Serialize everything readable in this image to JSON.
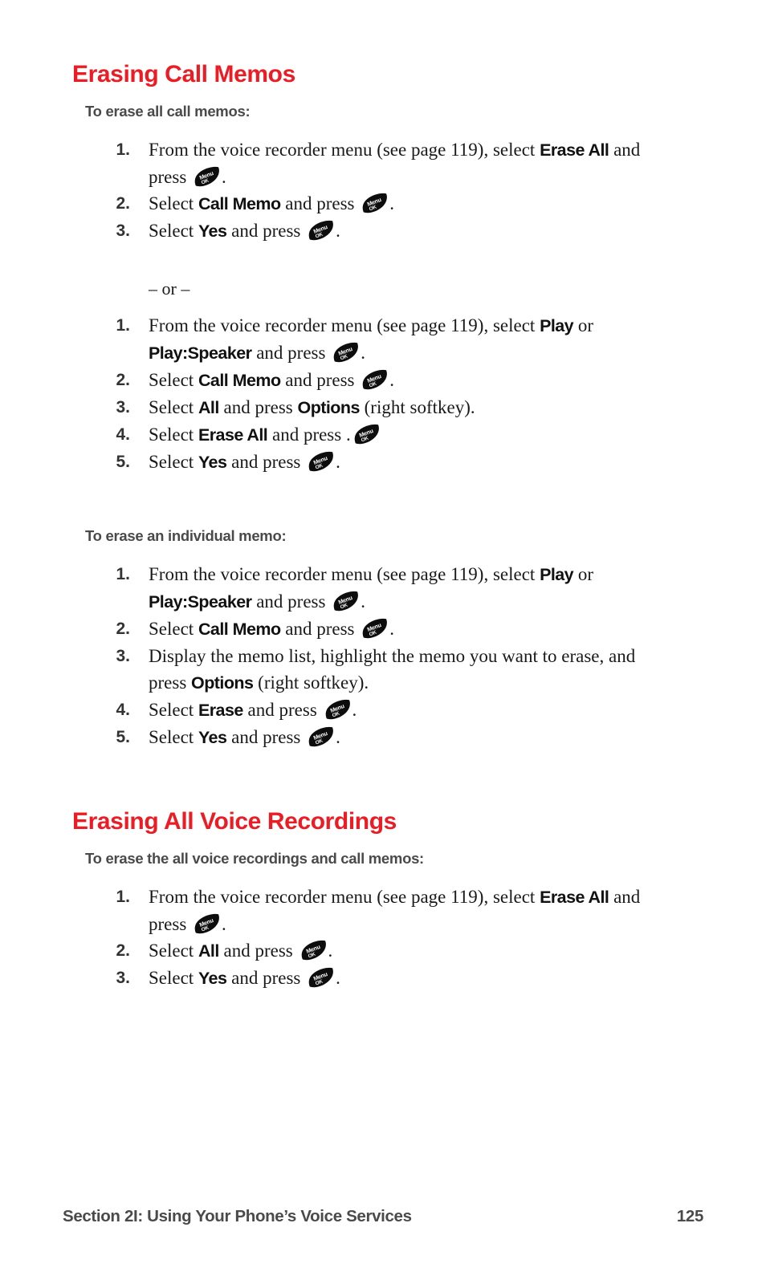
{
  "page": {
    "number": "125",
    "footer_section": "Section 2I: Using Your Phone’s Voice Services",
    "accent_color": "#ec1c24",
    "body_color": "#1a1a1a",
    "subheading_color": "#4a4a4a"
  },
  "icons": {
    "menu_ok": {
      "line1": "Menu",
      "line2": "OK",
      "name": "menu-ok-key-icon"
    }
  },
  "sections": [
    {
      "heading": "Erasing Call Memos",
      "groups": [
        {
          "subheading": "To erase all call memos:",
          "steps": [
            {
              "num": "1.",
              "parts": [
                {
                  "t": "text",
                  "v": "From the voice recorder menu (see page 119), select "
                },
                {
                  "t": "ui",
                  "v": "Erase All"
                },
                {
                  "t": "text",
                  "v": " and press "
                },
                {
                  "t": "icon",
                  "v": "menu_ok"
                },
                {
                  "t": "text",
                  "v": "."
                }
              ]
            },
            {
              "num": "2.",
              "parts": [
                {
                  "t": "text",
                  "v": "Select "
                },
                {
                  "t": "ui",
                  "v": "Call Memo"
                },
                {
                  "t": "text",
                  "v": " and press "
                },
                {
                  "t": "icon",
                  "v": "menu_ok"
                },
                {
                  "t": "text",
                  "v": "."
                }
              ]
            },
            {
              "num": "3.",
              "parts": [
                {
                  "t": "text",
                  "v": "Select "
                },
                {
                  "t": "ui",
                  "v": "Yes"
                },
                {
                  "t": "text",
                  "v": " and press "
                },
                {
                  "t": "icon",
                  "v": "menu_ok"
                },
                {
                  "t": "text",
                  "v": "."
                }
              ]
            }
          ],
          "separator": "– or –",
          "steps_alt": [
            {
              "num": "1.",
              "parts": [
                {
                  "t": "text",
                  "v": "From the voice recorder menu (see page 119), select "
                },
                {
                  "t": "ui",
                  "v": "Play"
                },
                {
                  "t": "text",
                  "v": " or "
                },
                {
                  "t": "ui",
                  "v": "Play:Speaker"
                },
                {
                  "t": "text",
                  "v": " and press "
                },
                {
                  "t": "icon",
                  "v": "menu_ok"
                },
                {
                  "t": "text",
                  "v": "."
                }
              ]
            },
            {
              "num": "2.",
              "parts": [
                {
                  "t": "text",
                  "v": "Select "
                },
                {
                  "t": "ui",
                  "v": "Call Memo"
                },
                {
                  "t": "text",
                  "v": " and press "
                },
                {
                  "t": "icon",
                  "v": "menu_ok"
                },
                {
                  "t": "text",
                  "v": "."
                }
              ]
            },
            {
              "num": "3.",
              "parts": [
                {
                  "t": "text",
                  "v": "Select "
                },
                {
                  "t": "ui",
                  "v": "All"
                },
                {
                  "t": "text",
                  "v": " and press "
                },
                {
                  "t": "ui",
                  "v": "Options"
                },
                {
                  "t": "text",
                  "v": " (right softkey)."
                }
              ]
            },
            {
              "num": "4.",
              "parts": [
                {
                  "t": "text",
                  "v": "Select "
                },
                {
                  "t": "ui",
                  "v": "Erase All"
                },
                {
                  "t": "text",
                  "v": " and press ."
                },
                {
                  "t": "icon",
                  "v": "menu_ok"
                }
              ]
            },
            {
              "num": "5.",
              "parts": [
                {
                  "t": "text",
                  "v": "Select "
                },
                {
                  "t": "ui",
                  "v": "Yes"
                },
                {
                  "t": "text",
                  "v": " and press "
                },
                {
                  "t": "icon",
                  "v": "menu_ok"
                },
                {
                  "t": "text",
                  "v": "."
                }
              ]
            }
          ]
        },
        {
          "subheading": "To erase an individual memo:",
          "steps": [
            {
              "num": "1.",
              "parts": [
                {
                  "t": "text",
                  "v": "From the voice recorder menu (see page 119), select "
                },
                {
                  "t": "ui",
                  "v": "Play"
                },
                {
                  "t": "text",
                  "v": " or "
                },
                {
                  "t": "ui",
                  "v": "Play:Speaker"
                },
                {
                  "t": "text",
                  "v": " and press "
                },
                {
                  "t": "icon",
                  "v": "menu_ok"
                },
                {
                  "t": "text",
                  "v": "."
                }
              ]
            },
            {
              "num": "2.",
              "parts": [
                {
                  "t": "text",
                  "v": "Select "
                },
                {
                  "t": "ui",
                  "v": "Call Memo"
                },
                {
                  "t": "text",
                  "v": " and press "
                },
                {
                  "t": "icon",
                  "v": "menu_ok"
                },
                {
                  "t": "text",
                  "v": "."
                }
              ]
            },
            {
              "num": "3.",
              "parts": [
                {
                  "t": "text",
                  "v": "Display the memo list, highlight the memo you want to erase, and press "
                },
                {
                  "t": "ui",
                  "v": "Options"
                },
                {
                  "t": "text",
                  "v": " (right softkey)."
                }
              ]
            },
            {
              "num": "4.",
              "parts": [
                {
                  "t": "text",
                  "v": "Select "
                },
                {
                  "t": "ui",
                  "v": "Erase"
                },
                {
                  "t": "text",
                  "v": " and press "
                },
                {
                  "t": "icon",
                  "v": "menu_ok"
                },
                {
                  "t": "text",
                  "v": "."
                }
              ]
            },
            {
              "num": "5.",
              "parts": [
                {
                  "t": "text",
                  "v": "Select "
                },
                {
                  "t": "ui",
                  "v": "Yes"
                },
                {
                  "t": "text",
                  "v": " and press "
                },
                {
                  "t": "icon",
                  "v": "menu_ok"
                },
                {
                  "t": "text",
                  "v": "."
                }
              ]
            }
          ]
        }
      ]
    },
    {
      "heading": "Erasing All Voice Recordings",
      "groups": [
        {
          "subheading": "To erase the all voice recordings and call memos:",
          "steps": [
            {
              "num": "1.",
              "parts": [
                {
                  "t": "text",
                  "v": "From the voice recorder menu (see page 119), select "
                },
                {
                  "t": "ui",
                  "v": "Erase All"
                },
                {
                  "t": "text",
                  "v": " and press "
                },
                {
                  "t": "icon",
                  "v": "menu_ok"
                },
                {
                  "t": "text",
                  "v": "."
                }
              ]
            },
            {
              "num": "2.",
              "parts": [
                {
                  "t": "text",
                  "v": "Select "
                },
                {
                  "t": "ui",
                  "v": "All"
                },
                {
                  "t": "text",
                  "v": " and press "
                },
                {
                  "t": "icon",
                  "v": "menu_ok"
                },
                {
                  "t": "text",
                  "v": "."
                }
              ]
            },
            {
              "num": "3.",
              "parts": [
                {
                  "t": "text",
                  "v": "Select "
                },
                {
                  "t": "ui",
                  "v": "Yes"
                },
                {
                  "t": "text",
                  "v": " and press "
                },
                {
                  "t": "icon",
                  "v": "menu_ok"
                },
                {
                  "t": "text",
                  "v": "."
                }
              ]
            }
          ]
        }
      ]
    }
  ]
}
